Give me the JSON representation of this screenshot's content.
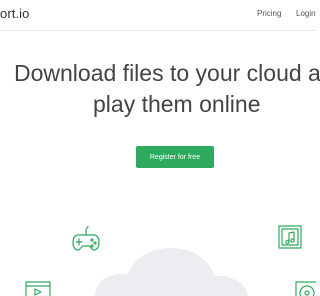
{
  "header": {
    "logo_text": "ort.io",
    "nav": {
      "pricing": "Pricing",
      "login": "Login"
    }
  },
  "hero": {
    "headline_line1": "Download files to your cloud ar",
    "headline_line2": "play them online",
    "cta_label": "Register for free"
  },
  "colors": {
    "accent": "#2eaa5f",
    "cloud": "#ebedf0",
    "text": "#444444"
  },
  "icons": [
    "gamepad-icon",
    "music-file-icon",
    "video-player-icon",
    "disc-icon"
  ]
}
